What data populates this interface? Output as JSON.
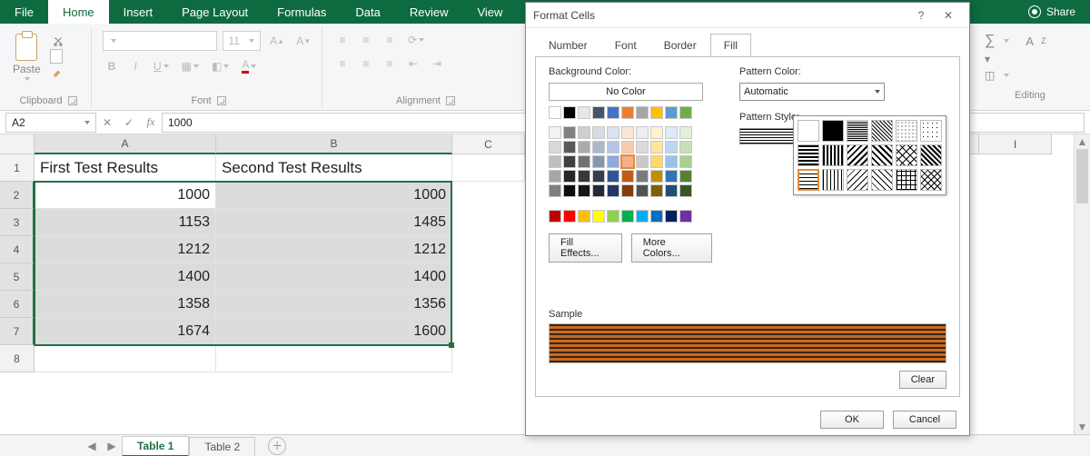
{
  "ribbon": {
    "tabs": [
      "File",
      "Home",
      "Insert",
      "Page Layout",
      "Formulas",
      "Data",
      "Review",
      "View"
    ],
    "active_tab": "Home",
    "share": "Share",
    "groups": {
      "clipboard": {
        "label": "Clipboard",
        "paste": "Paste"
      },
      "font": {
        "label": "Font",
        "size": "11",
        "bold": "B",
        "italic": "I",
        "underline": "U"
      },
      "alignment": {
        "label": "Alignment"
      },
      "editing": {
        "label": "Editing"
      }
    }
  },
  "formula_bar": {
    "name_box": "A2",
    "formula": "1000"
  },
  "grid": {
    "columns": [
      "A",
      "B",
      "C",
      "I"
    ],
    "rows": [
      "1",
      "2",
      "3",
      "4",
      "5",
      "6",
      "7",
      "8"
    ],
    "headers": {
      "A": "First Test Results",
      "B": "Second Test Results"
    },
    "data": {
      "A": [
        "1000",
        "1153",
        "1212",
        "1400",
        "1358",
        "1674"
      ],
      "B": [
        "1000",
        "1485",
        "1212",
        "1400",
        "1356",
        "1600"
      ]
    },
    "selection": {
      "start": "A2",
      "end": "B7",
      "active": "A2"
    }
  },
  "sheets": {
    "tabs": [
      "Table 1",
      "Table 2"
    ],
    "active": "Table 1"
  },
  "dialog": {
    "title": "Format Cells",
    "help": "?",
    "tabs": [
      "Number",
      "Font",
      "Border",
      "Fill"
    ],
    "active_tab": "Fill",
    "bg_label": "Background Color:",
    "no_color": "No Color",
    "pattern_color_label": "Pattern Color:",
    "pattern_color_value": "Automatic",
    "pattern_style_label": "Pattern Style:",
    "fill_effects": "Fill Effects...",
    "more_colors": "More Colors...",
    "sample_label": "Sample",
    "clear": "Clear",
    "ok": "OK",
    "cancel": "Cancel",
    "theme_colors_row1": [
      "#ffffff",
      "#000000",
      "#e7e6e6",
      "#44546a",
      "#4472c4",
      "#ed7d31",
      "#a5a5a5",
      "#ffc000",
      "#5b9bd5",
      "#70ad47"
    ],
    "theme_shades": [
      [
        "#f2f2f2",
        "#808080",
        "#d0cece",
        "#d6dce4",
        "#d9e1f2",
        "#fce4d6",
        "#ededed",
        "#fff2cc",
        "#ddebf7",
        "#e2efda"
      ],
      [
        "#d9d9d9",
        "#595959",
        "#aeaaaa",
        "#acb9ca",
        "#b4c6e7",
        "#f8cbad",
        "#dbdbdb",
        "#ffe699",
        "#bdd7ee",
        "#c6e0b4"
      ],
      [
        "#bfbfbf",
        "#404040",
        "#767171",
        "#8497b0",
        "#8ea9db",
        "#f4b084",
        "#c9c9c9",
        "#ffd966",
        "#9bc2e6",
        "#a9d08e"
      ],
      [
        "#a6a6a6",
        "#262626",
        "#3a3838",
        "#333f4f",
        "#305496",
        "#c65911",
        "#7b7b7b",
        "#bf8f00",
        "#2f75b5",
        "#548235"
      ],
      [
        "#808080",
        "#0d0d0d",
        "#161616",
        "#222b35",
        "#203764",
        "#833c0c",
        "#525252",
        "#806000",
        "#1f4e78",
        "#375623"
      ]
    ],
    "standard_colors": [
      "#c00000",
      "#ff0000",
      "#ffc000",
      "#ffff00",
      "#92d050",
      "#00b050",
      "#00b0f0",
      "#0070c0",
      "#002060",
      "#7030a0"
    ],
    "selected_theme": {
      "row": 3,
      "col": 5
    }
  }
}
